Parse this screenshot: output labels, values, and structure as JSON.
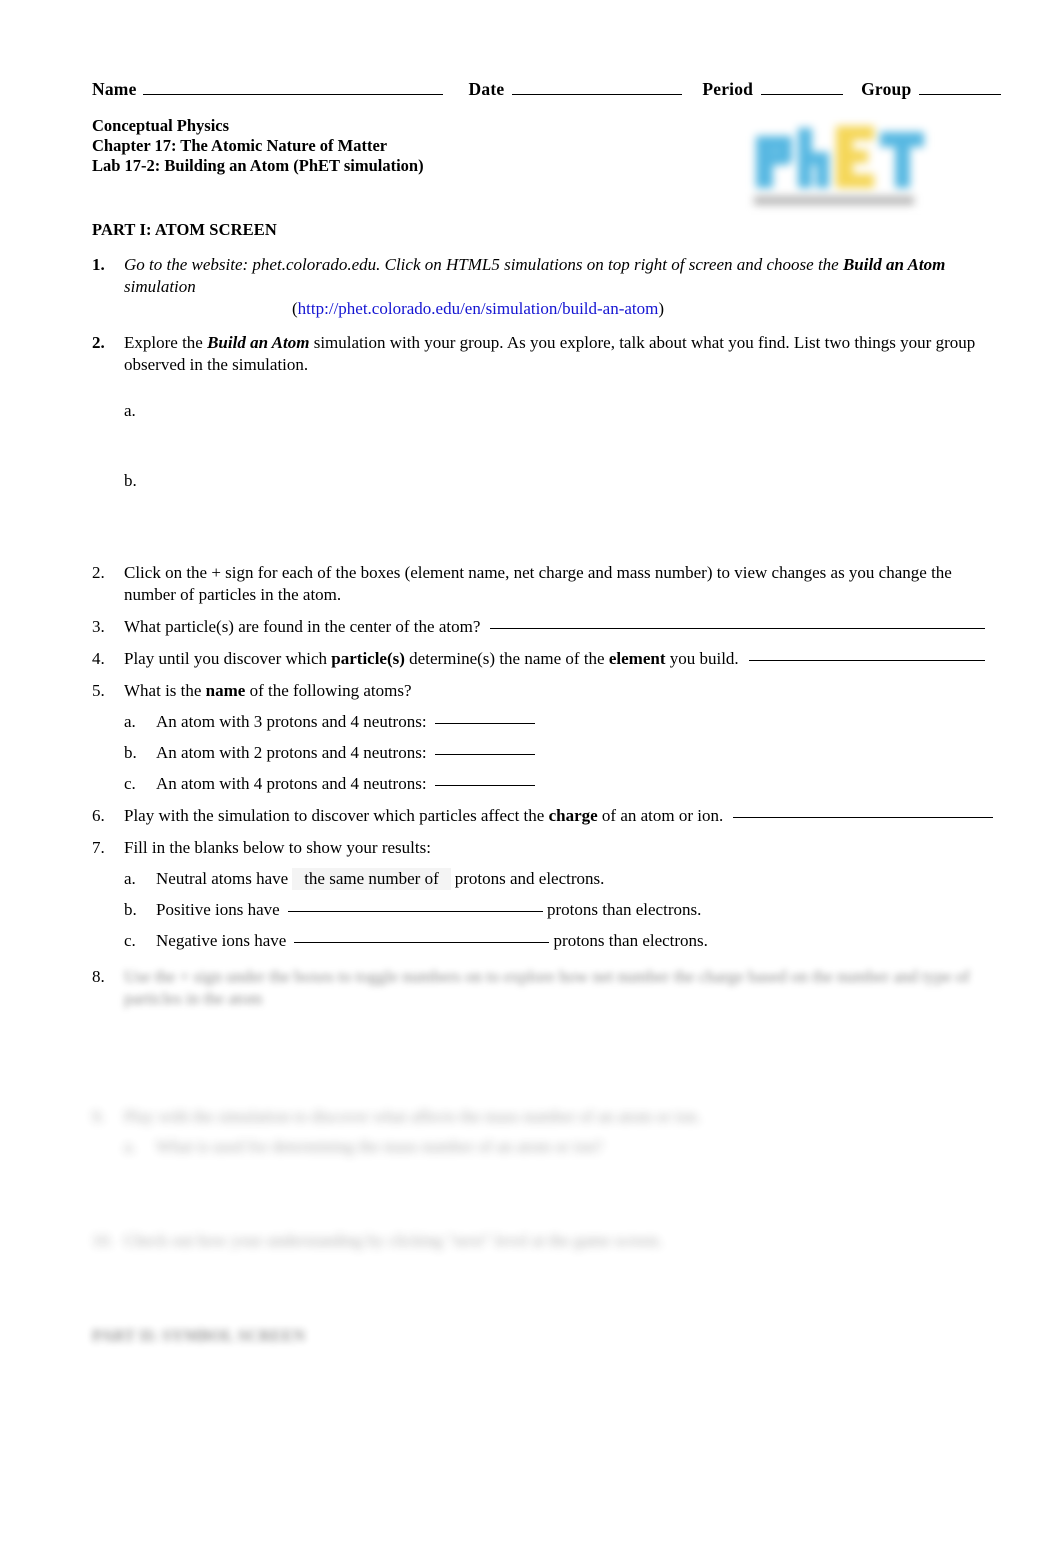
{
  "document": {
    "header": {
      "name_label": "Name",
      "date_label": "Date",
      "period_label": "Period",
      "group_label": "Group"
    },
    "course": {
      "line1": "Conceptual Physics",
      "line2": "Chapter 17:  The Atomic Nature of Matter",
      "line3": "Lab 17-2:  Building an Atom (PhET simulation)"
    },
    "logo": {
      "name": "phet-logo",
      "text": "PhET",
      "tagline": "Interactive Simulations",
      "color_blue": "#4ab3e0",
      "color_yellow": "#f5d44c",
      "color_gray": "#9a9a9a"
    },
    "part1": {
      "heading": "PART I: ATOM SCREEN",
      "item1": {
        "number": "1.",
        "text_a": "Go to the website:  phet.colorado.edu.  Click on HTML5 simulations on top right of screen and choose the ",
        "text_b": "Build an Atom",
        "text_c": " simulation",
        "url_open": "(",
        "url": "http://phet.colorado.edu/en/simulation/build-an-atom",
        "url_close": ")"
      },
      "item2": {
        "number": "2.",
        "text_a": "Explore the ",
        "text_b": "Build an Atom",
        "text_c": " simulation with your group. As you explore, talk about what you find.   List two things your group observed in the simulation.",
        "sub_a": "a.",
        "sub_b": "b."
      },
      "item3": {
        "number": "2.",
        "text": "Click on the + sign for each of the boxes (element name, net charge and mass number) to view changes as you change the number of particles in the atom."
      },
      "item4": {
        "number": "3.",
        "text": "What particle(s) are found in the center of the atom?"
      },
      "item5": {
        "number": "4.",
        "text_a": "Play until you discover which ",
        "text_b": "particle(s)",
        "text_c": " determine(s) the name of the ",
        "text_d": "element",
        "text_e": " you build."
      },
      "item6": {
        "number": "5.",
        "text_a": "What is the ",
        "text_b": "name",
        "text_c": " of the following atoms?",
        "subs": [
          {
            "letter": "a.",
            "text": "An atom with 3 protons and 4 neutrons:"
          },
          {
            "letter": "b.",
            "text": "An atom with 2 protons and 4 neutrons:"
          },
          {
            "letter": "c.",
            "text": "An atom with 4 protons and 4 neutrons:"
          }
        ]
      },
      "item7": {
        "number": "6.",
        "text_a": "Play with the simulation to discover which particles affect the ",
        "text_b": "charge",
        "text_c": " of an atom or ion."
      },
      "item8": {
        "number": "7.",
        "text": "Fill in the blanks below to show your results:",
        "subs": [
          {
            "letter": "a.",
            "text_before": "Neutral atoms have",
            "answer": "the same number of",
            "text_after": "protons and electrons."
          },
          {
            "letter": "b.",
            "text_before": "Positive ions have",
            "answer": "",
            "text_after": "protons than electrons."
          },
          {
            "letter": "c.",
            "text_before": "Negative ions have",
            "answer": "",
            "text_after": "protons than electrons."
          }
        ]
      },
      "item9": {
        "number": "8.",
        "redacted_line1": "Use the + sign under the boxes to toggle numbers on to explore how net number the charge based on the number and type of particles",
        "redacted_line2": "in the atom"
      },
      "item10": {
        "number": "9.",
        "redacted_line1": "Play with the simulation to discover what affects the mass number of an atom or ion.",
        "sub_letter": "a.",
        "redacted_sub": "What is used for determining the mass number of an atom or ion?"
      },
      "item11": {
        "number": "10.",
        "redacted_line1": "Check out how your understanding by clicking \"next\" level at the game screen."
      }
    },
    "part2": {
      "redacted_heading": "PART II: SYMBOL SCREEN"
    }
  }
}
